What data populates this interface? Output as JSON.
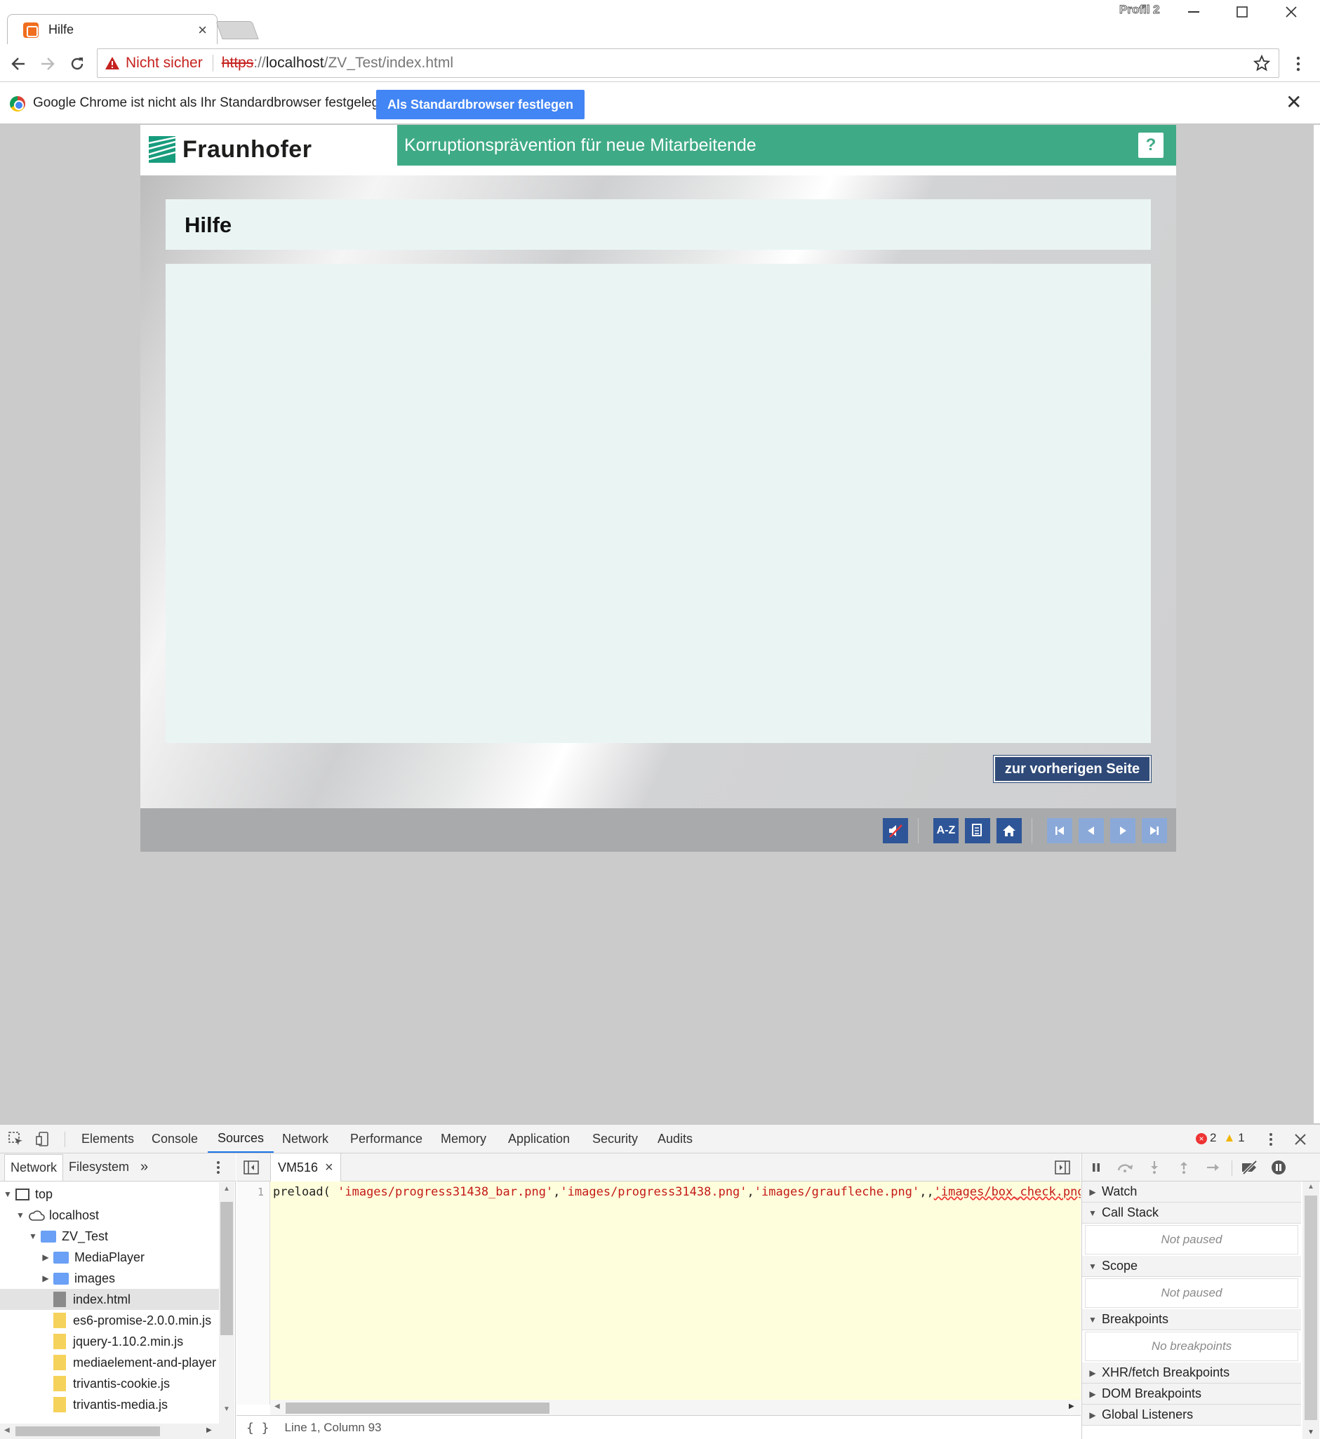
{
  "browser": {
    "tab": {
      "title": "Hilfe",
      "close": "×"
    },
    "profile": "Profil 2",
    "window_controls": {
      "minimize": "–",
      "maximize": "☐",
      "close": "✕"
    },
    "security_label": "Nicht sicher",
    "url": {
      "scheme": "https",
      "rest_prefix": "://",
      "host": "localhost",
      "path": "/ZV_Test/index.html"
    },
    "infobar": {
      "message": "Google Chrome ist nicht als Ihr Standardbrowser festgelegt.",
      "button": "Als Standardbrowser festlegen",
      "close": "✕"
    }
  },
  "app": {
    "brand": "Fraunhofer",
    "course_title": "Korruptionsprävention für neue Mitarbeitende",
    "help_button": "?",
    "page_heading": "Hilfe",
    "prev_page_button": "zur vorherigen Seite",
    "footer": {
      "glossary": "A-Z",
      "buttons": [
        "mute-icon",
        "glossary-button",
        "document-icon",
        "home-icon",
        "first-page-icon",
        "previous-page-icon",
        "next-page-icon",
        "last-page-icon"
      ]
    }
  },
  "devtools": {
    "tabs": [
      "Elements",
      "Console",
      "Sources",
      "Network",
      "Performance",
      "Memory",
      "Application",
      "Security",
      "Audits"
    ],
    "active_tab": "Sources",
    "errors": "2",
    "warnings": "1",
    "navigator": {
      "tabs": [
        "Network",
        "Filesystem"
      ],
      "more": "»",
      "tree": [
        {
          "label": "top",
          "depth": 0,
          "kind": "frame",
          "open": true
        },
        {
          "label": "localhost",
          "depth": 1,
          "kind": "cloud",
          "open": true
        },
        {
          "label": "ZV_Test",
          "depth": 2,
          "kind": "folder",
          "open": true
        },
        {
          "label": "MediaPlayer",
          "depth": 3,
          "kind": "folder",
          "open": false
        },
        {
          "label": "images",
          "depth": 3,
          "kind": "folder",
          "open": false
        },
        {
          "label": "index.html",
          "depth": 3,
          "kind": "html",
          "selected": true
        },
        {
          "label": "es6-promise-2.0.0.min.js",
          "depth": 3,
          "kind": "js"
        },
        {
          "label": "jquery-1.10.2.min.js",
          "depth": 3,
          "kind": "js"
        },
        {
          "label": "mediaelement-and-player",
          "depth": 3,
          "kind": "js"
        },
        {
          "label": "trivantis-cookie.js",
          "depth": 3,
          "kind": "js"
        },
        {
          "label": "trivantis-media.js",
          "depth": 3,
          "kind": "js"
        }
      ]
    },
    "editor": {
      "file_tab": "VM516",
      "file_tab_close": "×",
      "line_number": "1",
      "code_fn": "preload( ",
      "code_args": [
        "'images/progress31438_bar.png'",
        "'images/progress31438.png'",
        "'images/graufleche.png'",
        "",
        "'images/box_check.png'",
        ""
      ],
      "status_braces": "{ }",
      "status_position": "Line 1, Column 93"
    },
    "debugger": {
      "sections": [
        {
          "title": "Watch",
          "open": false
        },
        {
          "title": "Call Stack",
          "open": true,
          "empty": "Not paused"
        },
        {
          "title": "Scope",
          "open": true,
          "empty": "Not paused"
        },
        {
          "title": "Breakpoints",
          "open": true,
          "empty": "No breakpoints"
        },
        {
          "title": "XHR/fetch Breakpoints",
          "open": false
        },
        {
          "title": "DOM Breakpoints",
          "open": false
        },
        {
          "title": "Global Listeners",
          "open": false
        }
      ]
    }
  },
  "colors": {
    "accent_green": "#3faa86",
    "nav_blue": "#2e5598",
    "chrome_blue": "#4285f4",
    "warning_red": "#c5221f"
  }
}
